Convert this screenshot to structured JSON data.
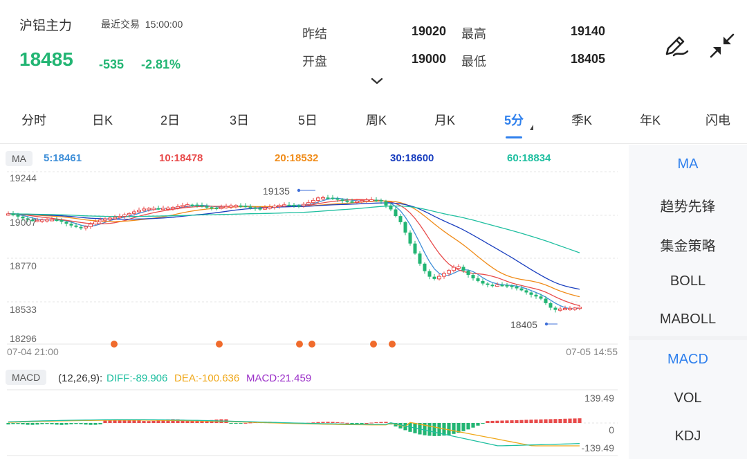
{
  "quote": {
    "symbol": "沪铝主力",
    "status_label": "最近交易",
    "time": "15:00:00",
    "last": "18485",
    "change": "-535",
    "change_pct": "-2.81%",
    "prev_settle_label": "昨结",
    "prev_settle": "19020",
    "open_label": "开盘",
    "open": "19000",
    "high_label": "最高",
    "high": "19140",
    "low_label": "最低",
    "low": "18405",
    "colors": {
      "down": "#22b573",
      "up": "#e84b4b"
    }
  },
  "tools": {
    "draw_icon": "pen-draw-icon",
    "collapse_icon": "collapse-arrows-icon"
  },
  "tabs": [
    {
      "label": "分时"
    },
    {
      "label": "日K"
    },
    {
      "label": "2日"
    },
    {
      "label": "3日"
    },
    {
      "label": "5日"
    },
    {
      "label": "周K"
    },
    {
      "label": "月K"
    },
    {
      "label": "5分",
      "active": true
    },
    {
      "label": "季K"
    },
    {
      "label": "年K"
    },
    {
      "label": "闪电"
    }
  ],
  "ma_bar": {
    "badge": "MA",
    "items": [
      {
        "label": "5:18461",
        "color": "#3f8fd8"
      },
      {
        "label": "10:18478",
        "color": "#e84b4b"
      },
      {
        "label": "20:18532",
        "color": "#f08c1a"
      },
      {
        "label": "30:18600",
        "color": "#1a3fbf"
      },
      {
        "label": "60:18834",
        "color": "#1fbfa0"
      }
    ]
  },
  "main_chart": {
    "y_ticks": [
      "19244",
      "18770",
      "18533",
      "18296"
    ],
    "y_tick_partial": "19007",
    "x_start": "07-04 21:00",
    "x_end": "07-05 14:55",
    "high_annotation": "19135",
    "low_annotation": "18405"
  },
  "macd_bar": {
    "badge": "MACD",
    "params": "(12,26,9):",
    "diff": "DIFF:-89.906",
    "dea": "DEA:-100.636",
    "macd": "MACD:21.459",
    "diff_color": "#1fbfa0",
    "dea_color": "#f0a81a",
    "macd_color": "#9b30c8"
  },
  "macd_chart": {
    "top": "139.49",
    "zero": "0",
    "bottom": "-139.49"
  },
  "side_main": [
    {
      "label": "MA",
      "active": true
    },
    {
      "label": "趋势先锋"
    },
    {
      "label": "集金策略"
    },
    {
      "label": "BOLL"
    },
    {
      "label": "MABOLL"
    }
  ],
  "side_sub": [
    {
      "label": "MACD",
      "active": true
    },
    {
      "label": "VOL"
    },
    {
      "label": "KDJ"
    }
  ]
}
